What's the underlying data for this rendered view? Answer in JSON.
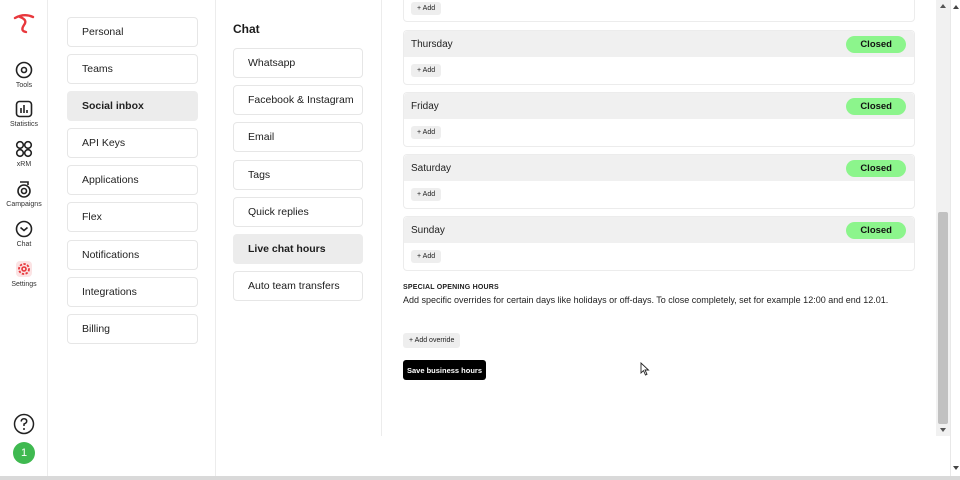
{
  "rail": {
    "items": [
      {
        "label": "Tools",
        "icon": "tools-icon"
      },
      {
        "label": "Statistics",
        "icon": "statistics-icon"
      },
      {
        "label": "xRM",
        "icon": "xrm-icon"
      },
      {
        "label": "Campaigns",
        "icon": "campaigns-icon"
      },
      {
        "label": "Chat",
        "icon": "chat-icon"
      },
      {
        "label": "Settings",
        "icon": "settings-icon"
      }
    ],
    "avatar": "1"
  },
  "settings": {
    "items": [
      "Personal",
      "Teams",
      "Social inbox",
      "API Keys",
      "Applications",
      "Flex",
      "Notifications",
      "Integrations",
      "Billing"
    ],
    "active": "Social inbox"
  },
  "chat": {
    "title": "Chat",
    "items": [
      "Whatsapp",
      "Facebook & Instagram",
      "Email",
      "Tags",
      "Quick replies",
      "Live chat hours",
      "Auto team transfers"
    ],
    "active": "Live chat hours"
  },
  "main": {
    "add_label": "+ Add",
    "days": [
      {
        "name": "Thursday",
        "status": "Closed"
      },
      {
        "name": "Friday",
        "status": "Closed"
      },
      {
        "name": "Saturday",
        "status": "Closed"
      },
      {
        "name": "Sunday",
        "status": "Closed"
      }
    ],
    "special_title": "SPECIAL OPENING HOURS",
    "special_desc": "Add specific overrides for certain days like holidays or off-days. To close completely, set for example 12:00 and end 12.01.",
    "override_label": "+ Add override",
    "save_label": "Save business hours"
  },
  "colors": {
    "closed_badge": "#8cf58c",
    "accent": "#e8383d",
    "settings_active": "#e8383d",
    "avatar": "#3fb950"
  }
}
